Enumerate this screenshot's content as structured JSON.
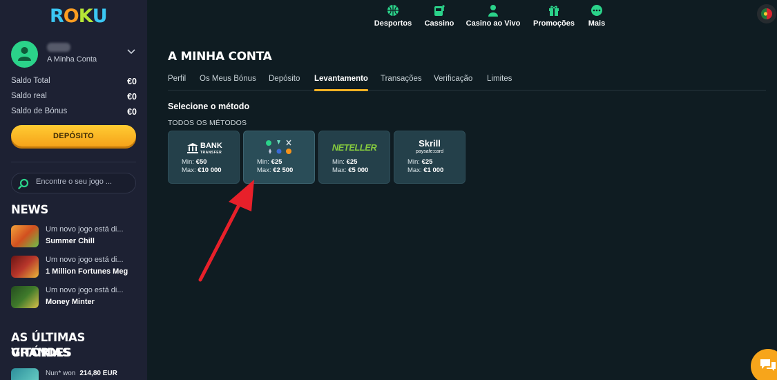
{
  "brand": {
    "logo_letters": [
      "R",
      "O",
      "K",
      "U"
    ]
  },
  "sidebar": {
    "account_label": "A Minha Conta",
    "balances": [
      {
        "label": "Saldo Total",
        "value": "€0"
      },
      {
        "label": "Saldo real",
        "value": "€0"
      },
      {
        "label": "Saldo de Bónus",
        "value": "€0"
      }
    ],
    "deposit_label": "DEPÓSITO",
    "search_placeholder": "Encontre o seu jogo ...",
    "news_title": "NEWS",
    "news": [
      {
        "text": "Um novo jogo está di...",
        "game": "Summer Chill"
      },
      {
        "text": "Um novo jogo está di...",
        "game": "1 Million Fortunes Meg"
      },
      {
        "text": "Um novo jogo está di...",
        "game": "Money Minter"
      }
    ],
    "wins_title_1": "AS ÚLTIMAS GRANDES",
    "wins_title_2": "VITÓRIAS",
    "wins": [
      {
        "user": "Nun* won",
        "amount": "214,80 EUR"
      }
    ]
  },
  "topnav": [
    {
      "label": "Desportos",
      "icon": "basketball-icon"
    },
    {
      "label": "Cassino",
      "icon": "slot-machine-icon"
    },
    {
      "label": "Casino ao Vivo",
      "icon": "dealer-icon"
    },
    {
      "label": "Promoções",
      "icon": "gift-icon"
    },
    {
      "label": "Mais",
      "icon": "more-icon"
    }
  ],
  "main": {
    "title": "A MINHA CONTA",
    "tabs": [
      "Perfil",
      "Os Meus Bónus",
      "Depósito",
      "Levantamento",
      "Transações",
      "Verificação",
      "Limites"
    ],
    "active_tab": "Levantamento",
    "section_title": "Selecione o método",
    "methods_label": "TODOS OS MÉTODOS",
    "methods": [
      {
        "name": "Bank Transfer",
        "logo_main": "BANK",
        "logo_sub": "TRANSFER",
        "min": "€50",
        "max": "€10 000"
      },
      {
        "name": "Crypto",
        "min": "€25",
        "max": "€2 500",
        "selected": true
      },
      {
        "name": "Neteller",
        "logo_main": "NETELLER",
        "min": "€25",
        "max": "€5 000"
      },
      {
        "name": "Skrill",
        "logo_main": "Skrill",
        "logo_sub": "paysafe:card",
        "min": "€25",
        "max": "€1 000"
      }
    ],
    "min_label": "Min:",
    "max_label": "Max:"
  },
  "colors": {
    "accent": "#f8b223",
    "bg": "#0f1c22",
    "sidebar": "#1d2133",
    "card": "#24404a",
    "green": "#2bd38a",
    "arrow": "#e8202a"
  }
}
